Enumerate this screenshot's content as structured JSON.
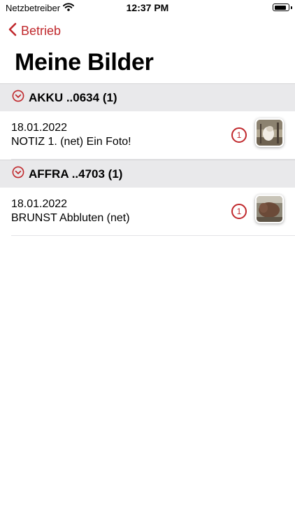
{
  "status_bar": {
    "carrier": "Netzbetreiber",
    "time": "12:37 PM",
    "battery_level": 0.9
  },
  "nav": {
    "back_label": "Betrieb",
    "title": "Meine Bilder"
  },
  "accent_color": "#c0282c",
  "sections": [
    {
      "title": "AKKU ..0634 (1)",
      "items": [
        {
          "date": "18.01.2022",
          "subtitle": "NOTIZ 1. (net) Ein Foto!",
          "count": "1",
          "thumbnail_icon": "cow-photo-thumbnail"
        }
      ]
    },
    {
      "title": "AFFRA ..4703 (1)",
      "items": [
        {
          "date": "18.01.2022",
          "subtitle": "BRUNST Abbluten (net)",
          "count": "1",
          "thumbnail_icon": "cow-photo-thumbnail"
        }
      ]
    }
  ]
}
